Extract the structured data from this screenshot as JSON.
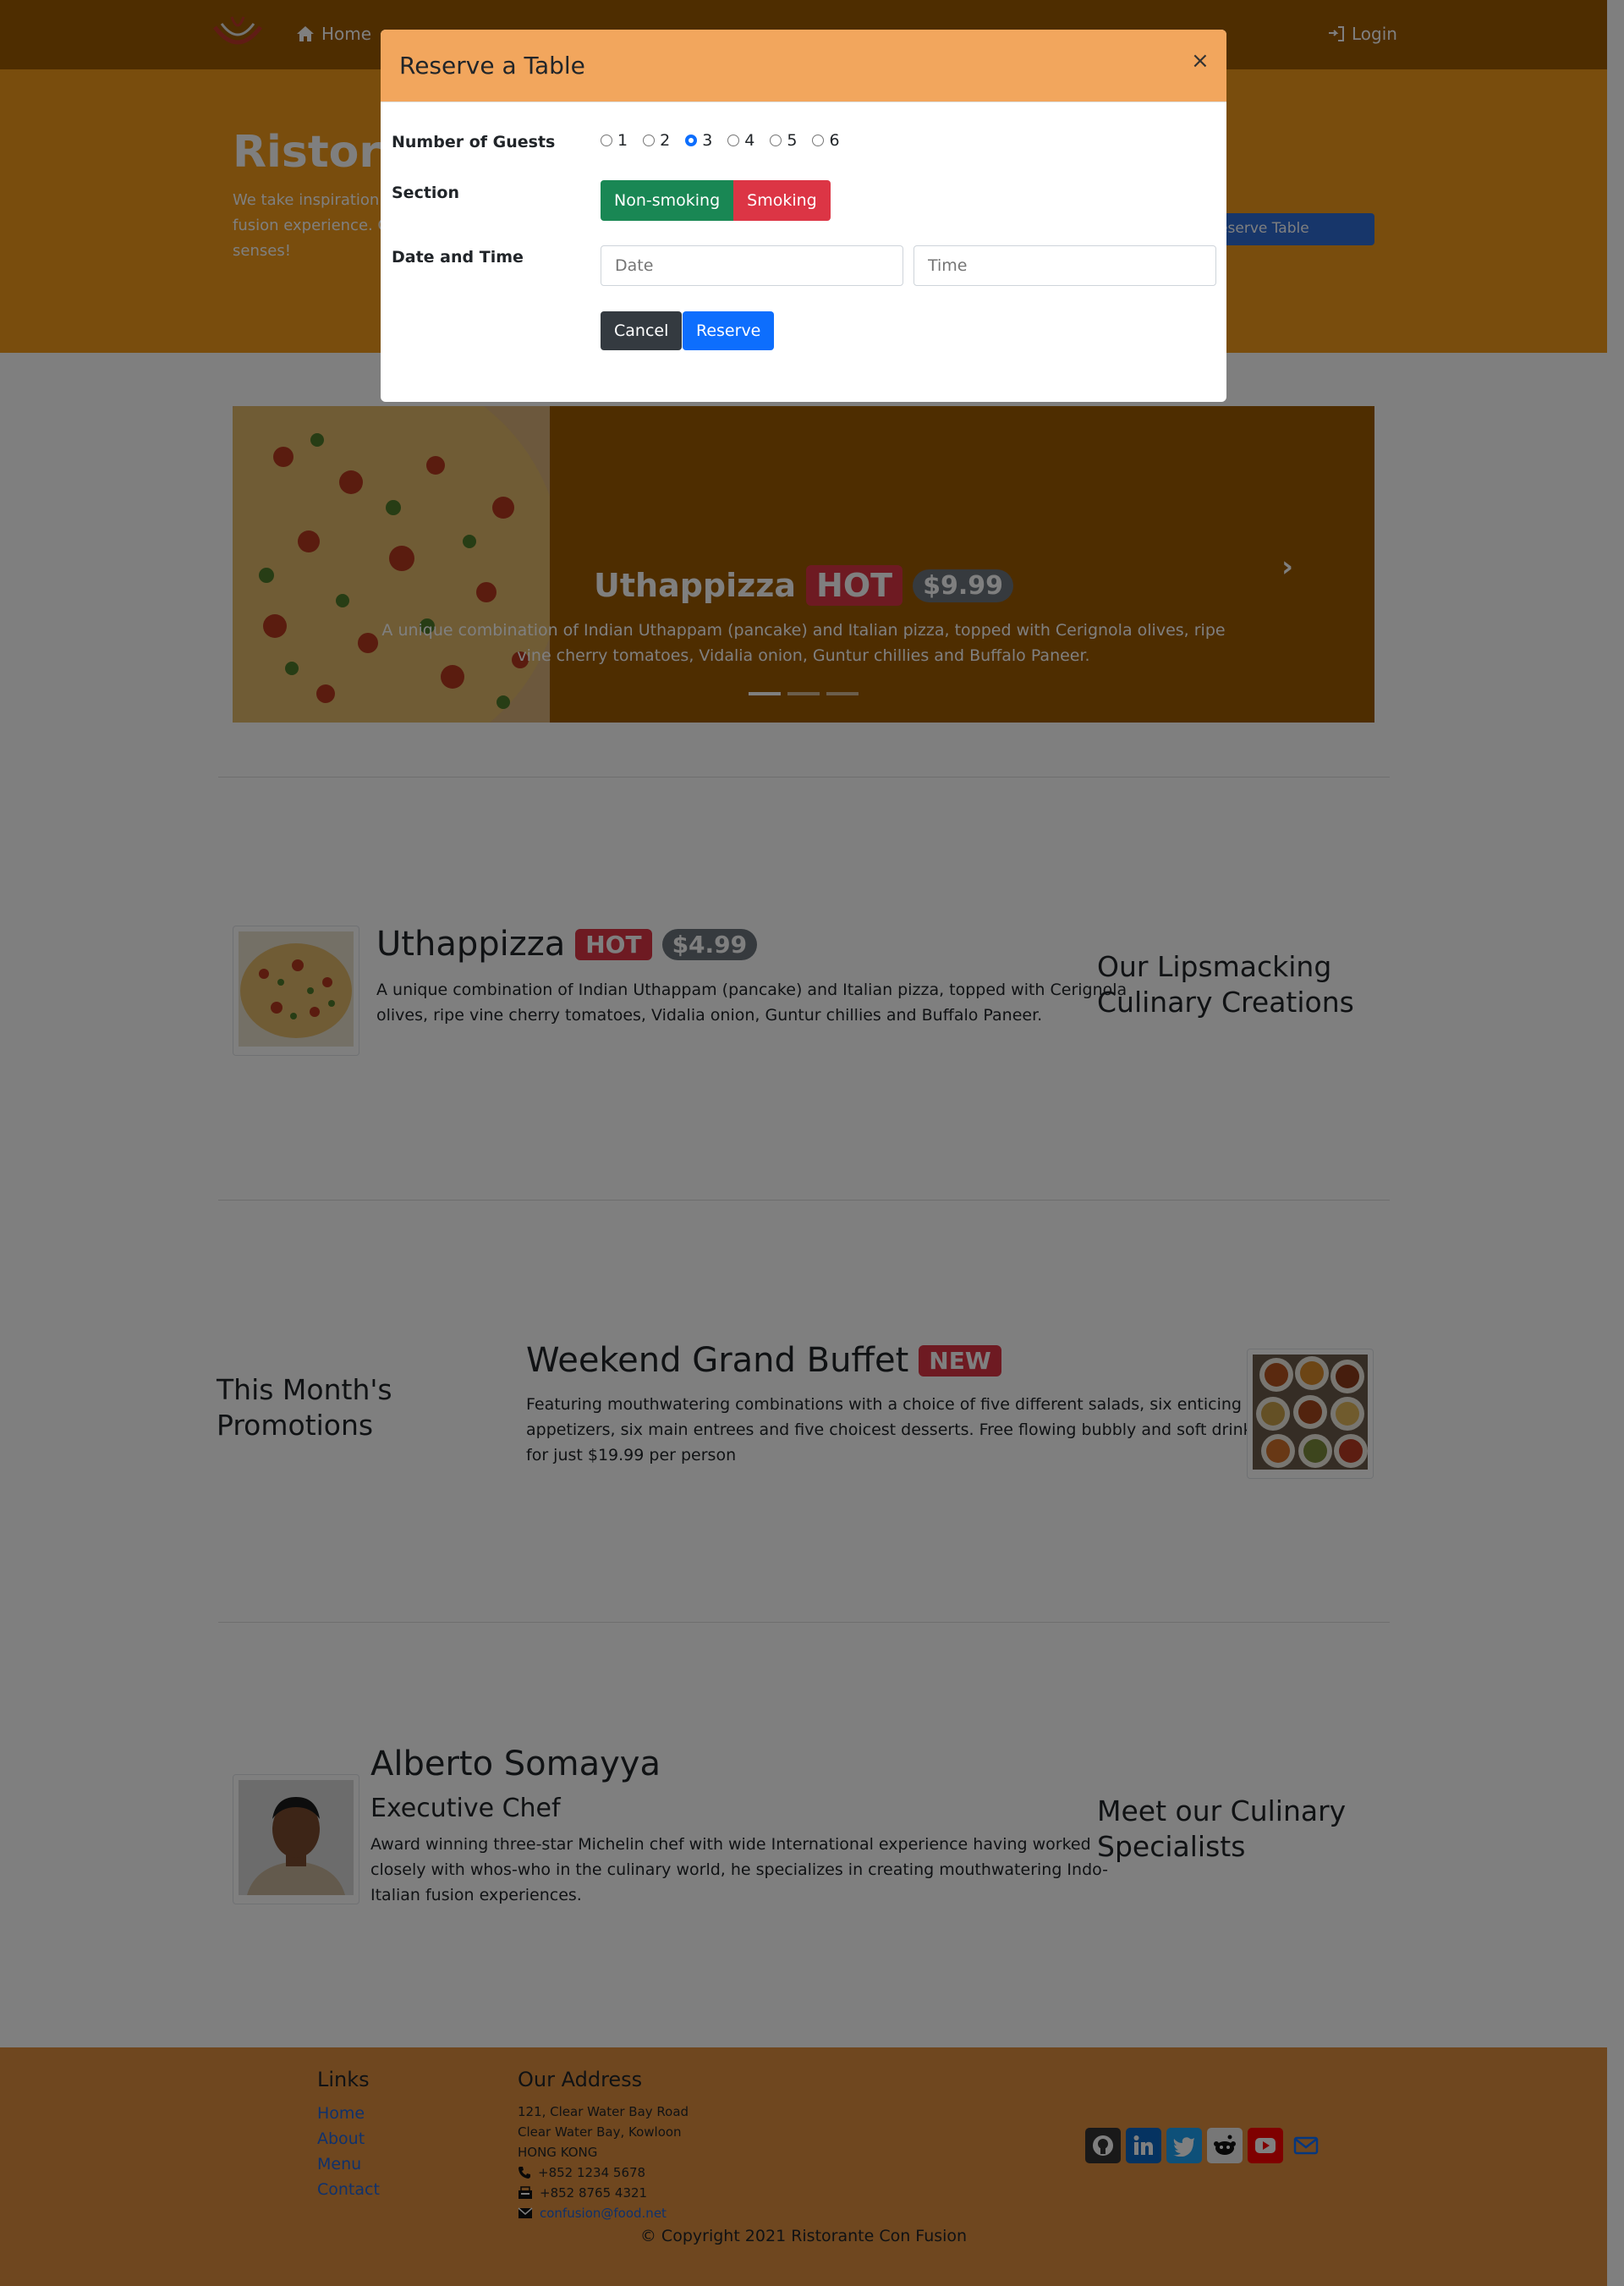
{
  "navbar": {
    "home": "Home",
    "login": "Login"
  },
  "jumbotron": {
    "title": "Ristorante Con Fusion",
    "text_lines": [
      "We take inspiration",
      "fusion experience. C",
      "senses!"
    ],
    "reserve_button": "Reserve Table"
  },
  "carousel": {
    "title": "Uthappizza",
    "badge": "HOT",
    "price": "$9.99",
    "description_lines": [
      "A unique combination of Indian Uthappam (pancake) and Italian pizza, topped with Cerignola olives, ripe",
      "vine cherry tomatoes, Vidalia onion, Guntur chillies and Buffalo Paneer."
    ]
  },
  "dish": {
    "title": "Uthappizza",
    "badge": "HOT",
    "price": "$4.99",
    "description_lines": [
      "A unique combination of Indian Uthappam (pancake) and Italian pizza, topped with Cerignola",
      "olives, ripe vine cherry tomatoes, Vidalia onion, Guntur chillies and Buffalo Paneer."
    ],
    "heading_lines": [
      "Our Lipsmacking",
      "Culinary Creations"
    ]
  },
  "promotion": {
    "heading_lines": [
      "This Month's",
      "Promotions"
    ],
    "title": "Weekend Grand Buffet",
    "badge": "NEW",
    "description_lines": [
      "Featuring mouthwatering combinations with a choice of five different salads, six enticing",
      "appetizers, six main entrees and five choicest desserts. Free flowing bubbly and soft drinks. All",
      "for just $19.99 per person"
    ]
  },
  "leader": {
    "name": "Alberto Somayya",
    "designation": "Executive Chef",
    "description_lines": [
      "Award winning three-star Michelin chef with wide International experience having worked",
      "closely with whos-who in the culinary world, he specializes in creating mouthwatering Indo-",
      "Italian fusion experiences."
    ],
    "heading_lines": [
      "Meet our Culinary",
      "Specialists"
    ]
  },
  "footer": {
    "links_heading": "Links",
    "links": [
      "Home",
      "About",
      "Menu",
      "Contact"
    ],
    "address_heading": "Our Address",
    "address_lines": [
      "121, Clear Water Bay Road",
      "Clear Water Bay, Kowloon",
      "HONG KONG"
    ],
    "phone": "+852 1234 5678",
    "fax": "+852 8765 4321",
    "email": "confusion@food.net",
    "social_icons": [
      "github-icon",
      "linkedin-icon",
      "twitter-icon",
      "reddit-icon",
      "youtube-icon",
      "mail-icon"
    ],
    "copyright": "© Copyright 2021 Ristorante Con Fusion"
  },
  "modal": {
    "title": "Reserve a Table",
    "close": "×",
    "guests_label": "Number of Guests",
    "guest_options": [
      "1",
      "2",
      "3",
      "4",
      "5",
      "6"
    ],
    "guests_selected": "3",
    "section_label": "Section",
    "section_options": [
      "Non-smoking",
      "Smoking"
    ],
    "datetime_label": "Date and Time",
    "date_placeholder": "Date",
    "time_placeholder": "Time",
    "cancel_button": "Cancel",
    "reserve_button": "Reserve"
  },
  "colors": {
    "navbar": "#9c5a00",
    "jumbotron": "#f29b1a",
    "footer": "#df8e3e",
    "modal_header": "#f2a65d",
    "primary": "#0d6efd",
    "danger": "#dc3545",
    "success": "#198754"
  }
}
